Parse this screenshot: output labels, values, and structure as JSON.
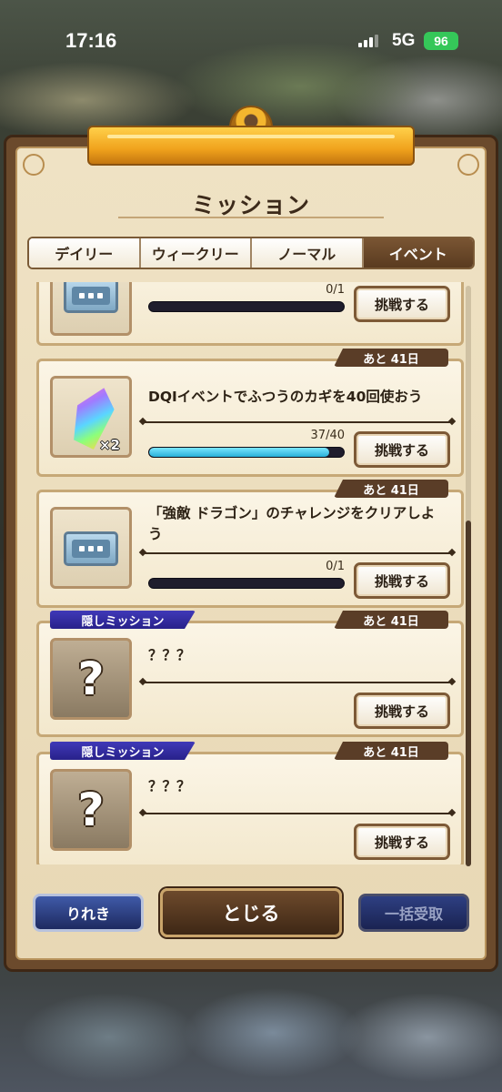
{
  "status_bar": {
    "time": "17:16",
    "network": "5G",
    "battery": "96"
  },
  "dialog": {
    "title": "ミッション"
  },
  "tabs": [
    {
      "label": "デイリー",
      "active": false
    },
    {
      "label": "ウィークリー",
      "active": false
    },
    {
      "label": "ノーマル",
      "active": false
    },
    {
      "label": "イベント",
      "active": true
    }
  ],
  "missions": [
    {
      "reward_icon": "ticket-icon",
      "text": "",
      "progress": "0/1",
      "progress_fraction": 0,
      "button": "挑戦する"
    },
    {
      "days_left": "あと 41日",
      "reward_icon": "rainbow-crystal-icon",
      "reward_qty": "×2",
      "text": "DQⅠイベントでふつうのカギを40回使おう",
      "progress": "37/40",
      "progress_fraction": 0.925,
      "button": "挑戦する"
    },
    {
      "days_left": "あと 41日",
      "reward_icon": "ticket-icon",
      "text": "「強敵 ドラゴン」のチャレンジをクリアしよう",
      "progress": "0/1",
      "progress_fraction": 0,
      "button": "挑戦する"
    },
    {
      "tag": "隠しミッション",
      "days_left": "あと 41日",
      "reward_icon": "question-mark-icon",
      "reward_symbol": "?",
      "text": "？？？",
      "button": "挑戦する"
    },
    {
      "tag": "隠しミッション",
      "days_left": "あと 41日",
      "reward_icon": "question-mark-icon",
      "reward_symbol": "?",
      "text": "？？？",
      "button": "挑戦する"
    }
  ],
  "footer": {
    "history_label": "りれき",
    "close_label": "とじる",
    "claim_all_label": "一括受取"
  }
}
